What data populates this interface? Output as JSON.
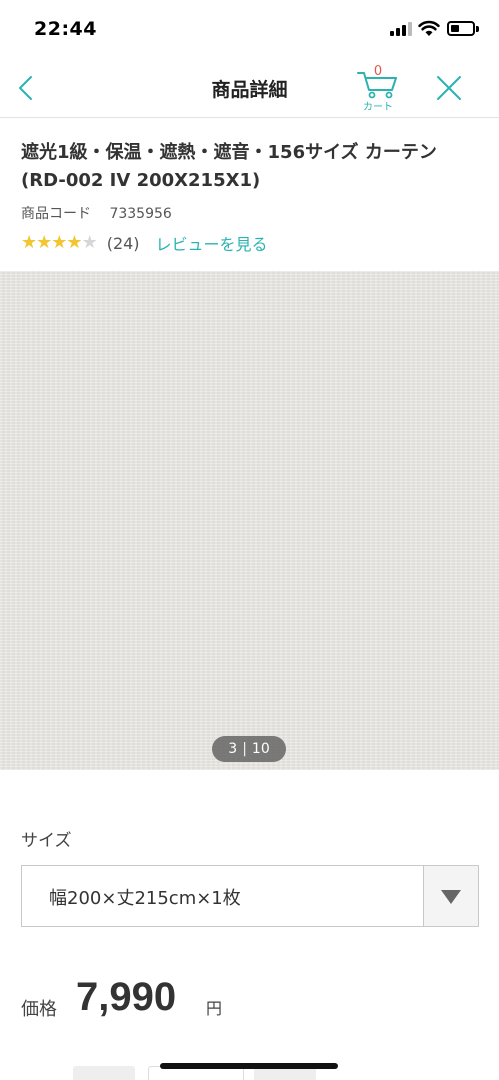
{
  "status_bar": {
    "time": "22:44"
  },
  "nav": {
    "title": "商品詳細",
    "cart_count": "0",
    "cart_label": "カート"
  },
  "product": {
    "title": "遮光1級・保温・遮熱・遮音・156サイズ カーテン (RD-002 IV 200X215X1)",
    "code_label": "商品コード",
    "code_value": "7335956",
    "rating": {
      "stars_filled": 4,
      "stars_total": 5,
      "review_count": "(24)",
      "review_link": "レビューを見る"
    }
  },
  "gallery": {
    "current": "3",
    "total": "10"
  },
  "size": {
    "label": "サイズ",
    "selected": "幅200×丈215cm×1枚"
  },
  "price": {
    "label": "価格",
    "value": "7,990",
    "unit": "円"
  },
  "colors": {
    "accent": "#2ab3b0",
    "cart_count": "#e2574c",
    "star": "#f2c531"
  }
}
